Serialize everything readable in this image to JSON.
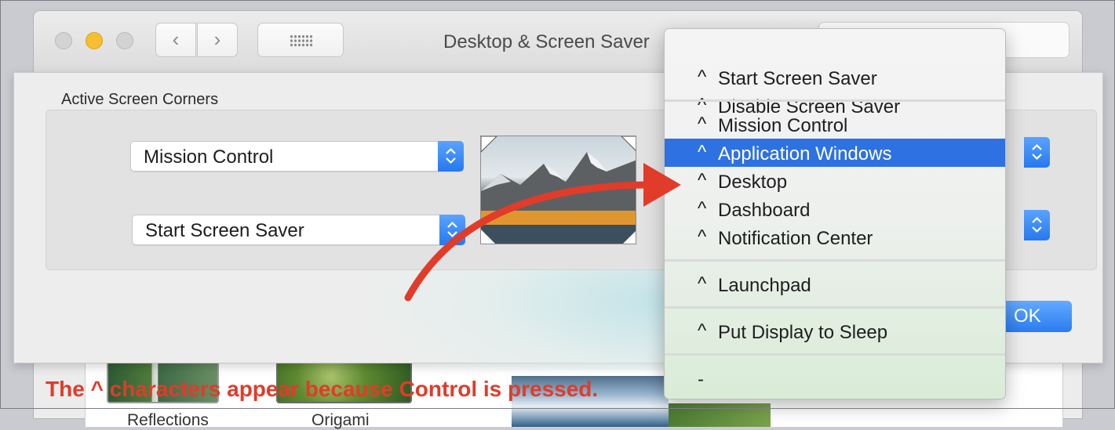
{
  "window": {
    "title": "Desktop & Screen Saver",
    "back_glyph": "‹",
    "forward_glyph": "›"
  },
  "sheet": {
    "title": "Active Screen Corners",
    "top_left_value": "Mission Control",
    "bottom_left_value": "Start Screen Saver",
    "ok_label": "OK"
  },
  "thumbnails": [
    {
      "label": "Reflections"
    },
    {
      "label": "Origami"
    }
  ],
  "menu": {
    "caret": "^",
    "items": [
      {
        "label": "Start Screen Saver"
      },
      {
        "label": "Disable Screen Saver"
      },
      {
        "label": "Mission Control"
      },
      {
        "label": "Application Windows"
      },
      {
        "label": "Desktop"
      },
      {
        "label": "Dashboard"
      },
      {
        "label": "Notification Center"
      },
      {
        "label": "Launchpad"
      },
      {
        "label": "Put Display to Sleep"
      },
      {
        "label": "-"
      }
    ],
    "selected": "Application Windows"
  },
  "annotation": {
    "text": "The ^ characters appear because Control is pressed.",
    "color": "#e13b2a"
  },
  "colors": {
    "accent": "#2e71e2",
    "traffic_yellow": "#f6bf2f"
  }
}
